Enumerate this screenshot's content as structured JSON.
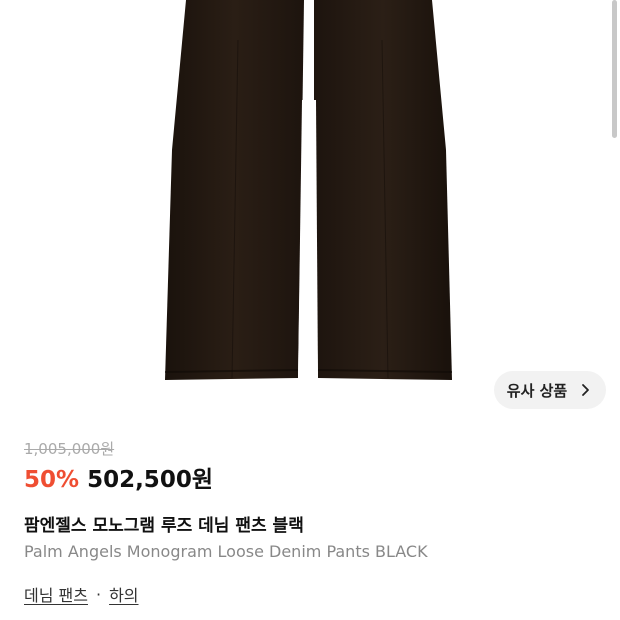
{
  "product": {
    "original_price": "1,005,000원",
    "discount": "50%",
    "sale_price": "502,500원",
    "title_ko": "팜엔젤스 모노그램 루즈 데님 팬츠 블랙",
    "title_en": "Palm Angels Monogram Loose Denim Pants BLACK"
  },
  "similar_button": {
    "label": "유사 상품",
    "icon": "chevron-right-icon"
  },
  "breadcrumb": {
    "items": [
      "데님 팬츠",
      "하의"
    ],
    "separator": "·"
  },
  "colors": {
    "discount": "#ef4e32",
    "pants": "#221811"
  }
}
